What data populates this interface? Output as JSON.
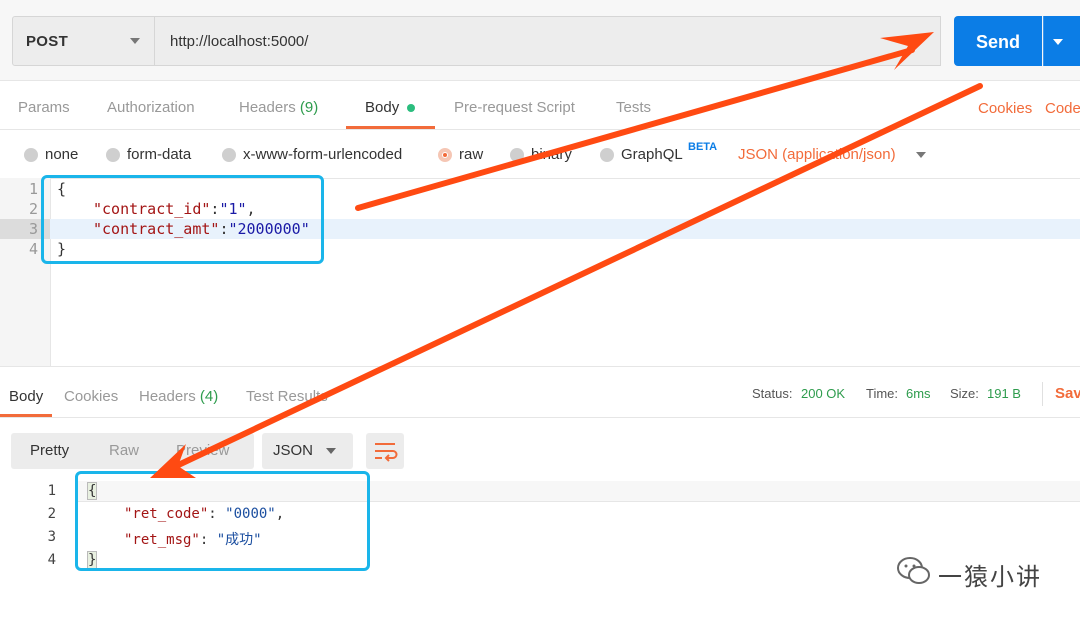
{
  "request": {
    "method": "POST",
    "url": "http://localhost:5000/",
    "send_label": "Send"
  },
  "request_tabs": [
    {
      "label": "Params"
    },
    {
      "label": "Authorization"
    },
    {
      "label": "Headers",
      "count": "(9)"
    },
    {
      "label": "Body"
    },
    {
      "label": "Pre-request Script"
    },
    {
      "label": "Tests"
    }
  ],
  "right_links": {
    "cookies": "Cookies",
    "code": "Code"
  },
  "body_types": {
    "none": "none",
    "form_data": "form-data",
    "urlencoded": "x-www-form-urlencoded",
    "raw": "raw",
    "binary": "binary",
    "graphql": "GraphQL",
    "beta": "BETA",
    "content_type": "JSON (application/json)"
  },
  "request_body": {
    "line_numbers": [
      "1",
      "2",
      "3",
      "4"
    ],
    "open": "{",
    "k1": "\"contract_id\"",
    "colon": ":",
    "v1": "\"1\"",
    "comma": ",",
    "k2": "\"contract_amt\"",
    "v2": "\"2000000\"",
    "close": "}"
  },
  "response_tabs": [
    {
      "label": "Body"
    },
    {
      "label": "Cookies"
    },
    {
      "label": "Headers",
      "count": "(4)"
    },
    {
      "label": "Test Results"
    }
  ],
  "status": {
    "status_label": "Status:",
    "status_value": "200 OK",
    "time_label": "Time:",
    "time_value": "6ms",
    "size_label": "Size:",
    "size_value": "191 B",
    "save": "Save"
  },
  "format": {
    "pretty": "Pretty",
    "raw": "Raw",
    "preview": "Preview",
    "language": "JSON"
  },
  "response_body": {
    "line_numbers": [
      "1",
      "2",
      "3",
      "4"
    ],
    "open": "{",
    "k1": "\"ret_code\"",
    "sep": ": ",
    "v1": "\"0000\"",
    "comma": ",",
    "k2": "\"ret_msg\"",
    "v2": "\"成功\"",
    "close": "}"
  },
  "watermark": "一猿小讲",
  "colors": {
    "accent": "#f26b3a",
    "send": "#0b7de6",
    "annotation_box": "#1ab5ea",
    "arrow": "#ff4a12"
  }
}
